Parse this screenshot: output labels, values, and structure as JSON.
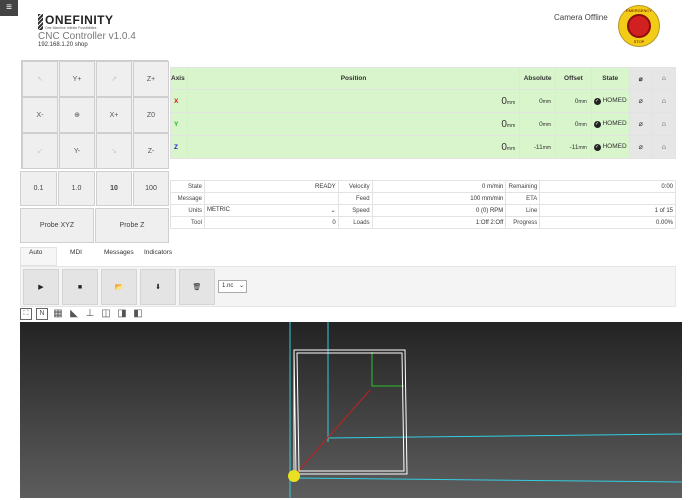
{
  "header": {
    "menu_icon": "≡",
    "logo_text": "ONEFINITY",
    "logo_sub": "One Machine Infinite Possibilities",
    "title": "CNC Controller v1.0.4",
    "ip": "192.168.1.20 shop",
    "camera_status": "Camera Offline",
    "estop_top": "EMERGENCY",
    "estop_bottom": "STOP"
  },
  "jog": {
    "buttons": [
      "↖",
      "Y+",
      "↗",
      "Z+",
      "X-",
      "⊕",
      "X+",
      "Z0",
      "↙",
      "Y-",
      "↘",
      "Z-"
    ],
    "steps": [
      "0.1",
      "1.0",
      "10",
      "100"
    ],
    "probe_xyz": "Probe XYZ",
    "probe_z": "Probe Z"
  },
  "axes": {
    "headers": {
      "axis": "Axis",
      "position": "Position",
      "absolute": "Absolute",
      "offset": "Offset",
      "state": "State",
      "zero": "⌀",
      "home": "⌂"
    },
    "rows": [
      {
        "axis": "X",
        "color": "#e01414",
        "position": "0",
        "pos_unit": "mm",
        "absolute": "0",
        "abs_unit": "mm",
        "offset": "0",
        "off_unit": "mm",
        "state": "HOMED"
      },
      {
        "axis": "Y",
        "color": "#22b422",
        "position": "0",
        "pos_unit": "mm",
        "absolute": "0",
        "abs_unit": "mm",
        "offset": "0",
        "off_unit": "mm",
        "state": "HOMED"
      },
      {
        "axis": "Z",
        "color": "#1418c8",
        "position": "0",
        "pos_unit": "mm",
        "absolute": "-11",
        "abs_unit": "mm",
        "offset": "-11",
        "off_unit": "mm",
        "state": "HOMED"
      }
    ]
  },
  "info": {
    "state_label": "State",
    "state": "READY",
    "velocity_label": "Velocity",
    "velocity": "0 m/min",
    "remaining_label": "Remaining",
    "remaining": "0:00",
    "message_label": "Message",
    "message": "",
    "feed_label": "Feed",
    "feed": "100 mm/min",
    "eta_label": "ETA",
    "eta": "",
    "units_label": "Units",
    "units": "METRIC",
    "speed_label": "Speed",
    "speed": "0 (0) RPM",
    "line_label": "Line",
    "line": "1 of 15",
    "tool_label": "Tool",
    "tool": "0",
    "loads_label": "Loads",
    "loads": "1:Off 2:Off",
    "progress_label": "Progress",
    "progress": "0.00%"
  },
  "tabs": [
    "Auto",
    "MDI",
    "Messages",
    "Indicators"
  ],
  "auto": {
    "play": "▶",
    "stop": "■",
    "folder": "📂",
    "download": "⬇",
    "delete": "🗑",
    "file": "1.nc"
  },
  "view_tools": [
    "⛶",
    "N",
    "▦",
    "◣",
    "⊥",
    "◫",
    "◨",
    "◧"
  ],
  "colors": {
    "position_bg": "#d8f5cb",
    "estop_yellow": "#f2cc17",
    "estop_red": "#d21f1f",
    "toolpath": "#ffffff",
    "grid_cyan": "#33cce0"
  }
}
